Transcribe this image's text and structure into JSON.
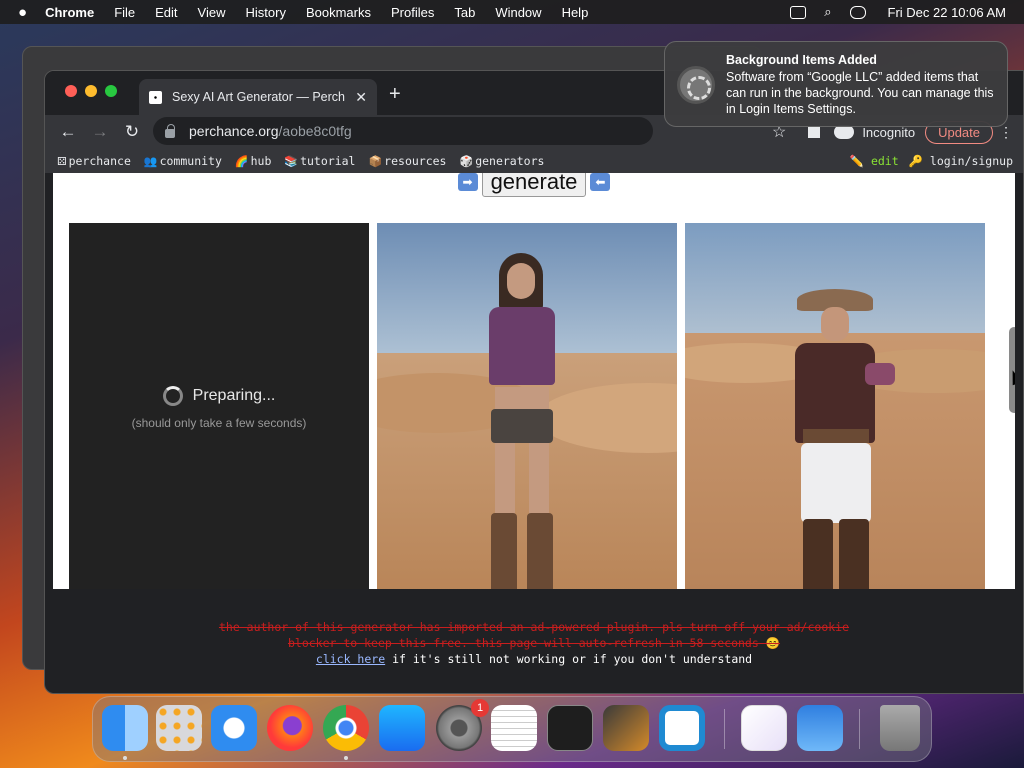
{
  "menubar": {
    "app": "Chrome",
    "items": [
      "File",
      "Edit",
      "View",
      "History",
      "Bookmarks",
      "Profiles",
      "Tab",
      "Window",
      "Help"
    ],
    "clock": "Fri Dec 22  10:06 AM"
  },
  "browser": {
    "tab_title": "Sexy AI Art Generator — Perch",
    "url_host": "perchance.org",
    "url_path": "/aobe8c0tfg",
    "incognito_label": "Incognito",
    "update_label": "Update",
    "bookmarks": [
      {
        "icon": "⚄",
        "label": "perchance"
      },
      {
        "icon": "👥",
        "label": "community"
      },
      {
        "icon": "🌈",
        "label": "hub"
      },
      {
        "icon": "📚",
        "label": "tutorial"
      },
      {
        "icon": "📦",
        "label": "resources"
      },
      {
        "icon": "🎲",
        "label": "generators"
      }
    ],
    "edit_label": "edit",
    "login_label": "login/signup"
  },
  "page": {
    "generate_label": "generate",
    "preparing": "Preparing...",
    "preparing_sub": "(should only take a few seconds)",
    "notice_line1": "the author of this generator has imported an ad-powered plugin. pls turn off your ad/cookie",
    "notice_line2": "blocker to keep this free. this page will auto-refresh in 58 seconds 😊",
    "notice_link": "click here",
    "notice_line3": " if it's still not working or if you don't understand"
  },
  "notification": {
    "title": "Background Items Added",
    "body": "Software from “Google LLC” added items that can run in the background. You can manage this in Login Items Settings."
  },
  "dock": {
    "settings_badge": "1",
    "apps": [
      "finder",
      "launchpad",
      "safari",
      "firefox",
      "chrome",
      "app-store",
      "system-settings",
      "textedit",
      "terminal",
      "garageband",
      "vscode",
      "visual-studio",
      "weather",
      "trash"
    ]
  }
}
